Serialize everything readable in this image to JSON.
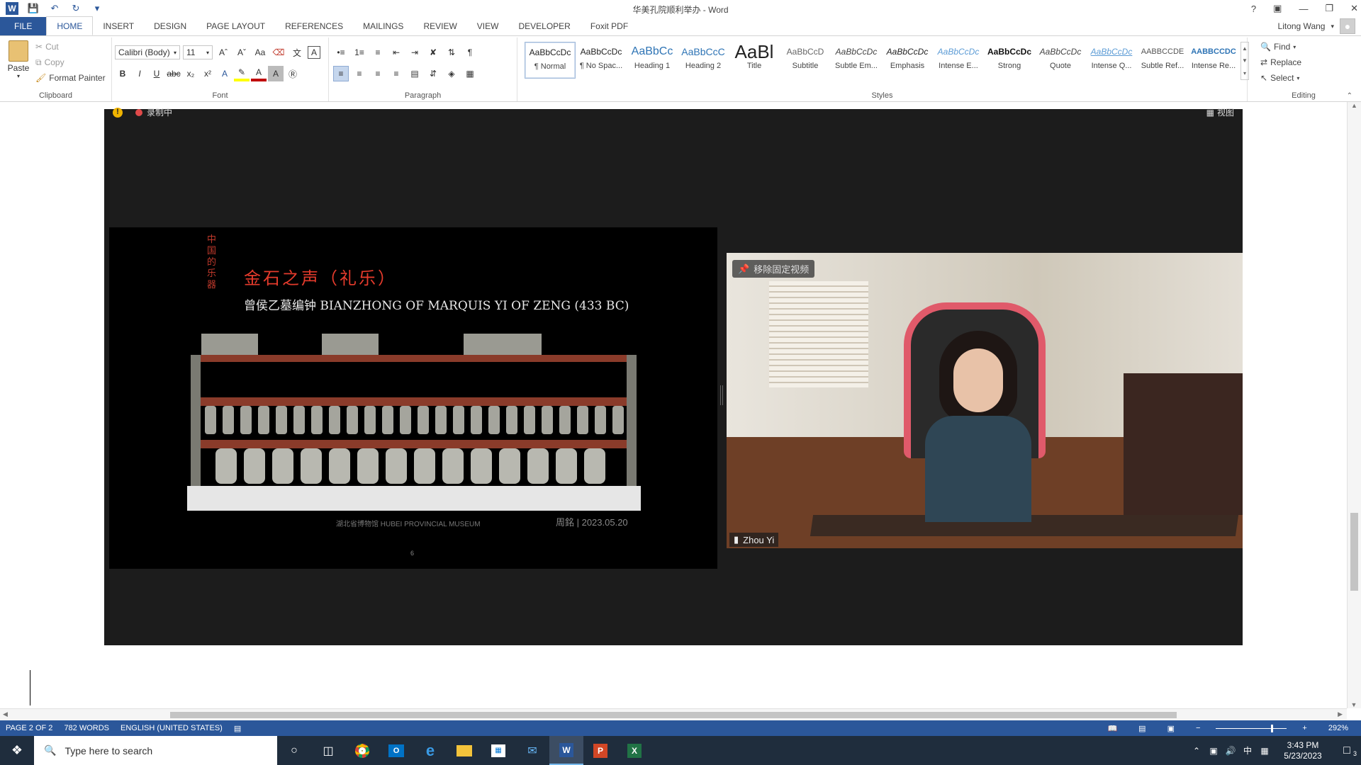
{
  "window": {
    "title": "华美孔院顺利举办 - Word"
  },
  "tabs": [
    "FILE",
    "HOME",
    "INSERT",
    "DESIGN",
    "PAGE LAYOUT",
    "REFERENCES",
    "MAILINGS",
    "REVIEW",
    "VIEW",
    "DEVELOPER",
    "Foxit PDF"
  ],
  "user": {
    "name": "Litong Wang"
  },
  "clipboard": {
    "paste": "Paste",
    "cut": "Cut",
    "copy": "Copy",
    "format_painter": "Format Painter",
    "label": "Clipboard"
  },
  "font": {
    "name": "Calibri (Body)",
    "size": "11",
    "label": "Font"
  },
  "paragraph": {
    "label": "Paragraph"
  },
  "styles": {
    "label": "Styles",
    "items": [
      {
        "preview": "AaBbCcDc",
        "name": "¶ Normal"
      },
      {
        "preview": "AaBbCcDc",
        "name": "¶ No Spac..."
      },
      {
        "preview": "AaBbCc",
        "name": "Heading 1"
      },
      {
        "preview": "AaBbCcC",
        "name": "Heading 2"
      },
      {
        "preview": "AaBl",
        "name": "Title"
      },
      {
        "preview": "AaBbCcD",
        "name": "Subtitle"
      },
      {
        "preview": "AaBbCcDc",
        "name": "Subtle Em..."
      },
      {
        "preview": "AaBbCcDc",
        "name": "Emphasis"
      },
      {
        "preview": "AaBbCcDc",
        "name": "Intense E..."
      },
      {
        "preview": "AaBbCcDc",
        "name": "Strong"
      },
      {
        "preview": "AaBbCcDc",
        "name": "Quote"
      },
      {
        "preview": "AaBbCcDc",
        "name": "Intense Q..."
      },
      {
        "preview": "AABBCCDE",
        "name": "Subtle Ref..."
      },
      {
        "preview": "AABBCCDC",
        "name": "Intense Re..."
      }
    ]
  },
  "editing": {
    "find": "Find",
    "replace": "Replace",
    "select": "Select",
    "label": "Editing"
  },
  "meeting": {
    "recording": "录制中",
    "view": "视图",
    "slide_title_cn": "金石之声（礼乐）",
    "slide_subtitle": "曾侯乙墓编钟 BIANZHONG OF MARQUIS YI OF ZENG (433 BC)",
    "slide_side": "中国的乐器",
    "slide_footer": "湖北省博物馆 HUBEI PROVINCIAL MUSEUM",
    "slide_date": "周銘 | 2023.05.20",
    "slide_page": "6",
    "pin_label": "移除固定视频",
    "participant": "Zhou Yi"
  },
  "status": {
    "page": "PAGE 2 OF 2",
    "words": "782 WORDS",
    "language": "ENGLISH (UNITED STATES)",
    "zoom": "292%"
  },
  "taskbar": {
    "search_placeholder": "Type here to search",
    "time": "3:43 PM",
    "date": "5/23/2023",
    "ime": "中",
    "notifications": "3"
  }
}
